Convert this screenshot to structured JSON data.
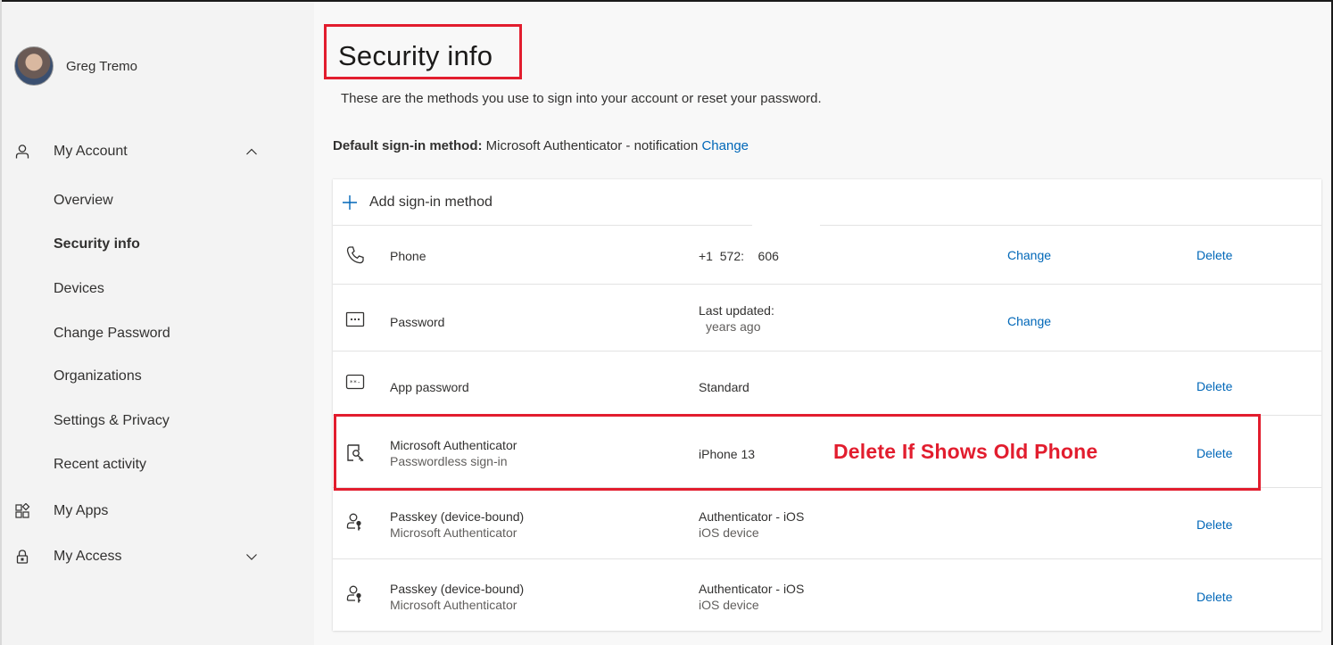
{
  "user": {
    "name": "Greg Tremo"
  },
  "sidebar": {
    "my_account": {
      "label": "My Account"
    },
    "items": [
      "Overview",
      "Security info",
      "Devices",
      "Change Password",
      "Organizations",
      "Settings & Privacy",
      "Recent activity"
    ],
    "active_item": "Security info",
    "my_apps": {
      "label": "My Apps"
    },
    "my_access": {
      "label": "My Access"
    }
  },
  "main": {
    "title": "Security info",
    "subtitle": "These are the methods you use to sign into your account or reset your password.",
    "default_method": {
      "label": "Default sign-in method:",
      "value": "Microsoft Authenticator - notification",
      "change": "Change"
    },
    "add_method": "Add sign-in method",
    "methods": [
      {
        "icon": "phone-icon",
        "name": "Phone",
        "detail": "+1  572:    606",
        "change": "Change",
        "delete": "Delete"
      },
      {
        "icon": "password-icon",
        "name": "Password",
        "detail_line1": "Last updated:",
        "detail_line2": "years ago",
        "change": "Change"
      },
      {
        "icon": "app-password-icon",
        "name": "App password",
        "detail": "Standard",
        "delete": "Delete"
      },
      {
        "icon": "authenticator-icon",
        "name": "Microsoft Authenticator",
        "sub": "Passwordless sign-in",
        "detail": "iPhone 13",
        "delete": "Delete"
      },
      {
        "icon": "passkey-icon",
        "name": "Passkey (device-bound)",
        "sub": "Microsoft Authenticator",
        "detail_line1": "Authenticator - iOS",
        "detail_line2": "iOS device",
        "delete": "Delete"
      },
      {
        "icon": "passkey-icon",
        "name": "Passkey (device-bound)",
        "sub": "Microsoft Authenticator",
        "detail_line1": "Authenticator - iOS",
        "detail_line2": "iOS device",
        "delete": "Delete"
      }
    ]
  },
  "annotation": {
    "text": "Delete If Shows Old Phone",
    "color": "#e21d2e"
  },
  "colors": {
    "link": "#0067b8",
    "highlight": "#e21d2e",
    "sidebar": "#f3f3f3"
  }
}
